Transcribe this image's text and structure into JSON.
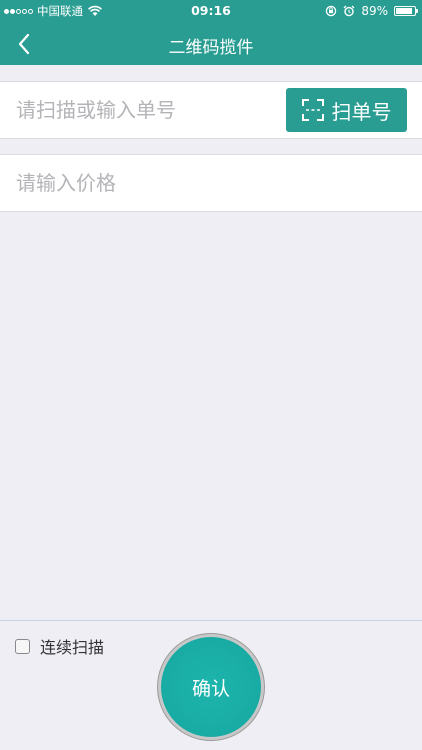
{
  "status_bar": {
    "carrier": "中国联通",
    "time": "09:16",
    "battery_percent_text": "89%",
    "battery_level": 0.89,
    "signal_bars_filled": 2,
    "signal_bars_total": 5
  },
  "nav": {
    "title": "二维码揽件",
    "back_icon": "chevron-left-icon"
  },
  "form": {
    "order_input": {
      "placeholder": "请扫描或输入单号",
      "value": ""
    },
    "scan_button": {
      "label": "扫单号",
      "icon": "scan-frame-icon"
    },
    "price_input": {
      "placeholder": "请输入价格",
      "value": ""
    }
  },
  "footer": {
    "continuous_scan_label": "连续扫描",
    "continuous_scan_checked": false,
    "confirm_label": "确认"
  },
  "colors": {
    "accent": "#2a9d93",
    "confirm": "#18aba3",
    "background": "#efeef4"
  }
}
